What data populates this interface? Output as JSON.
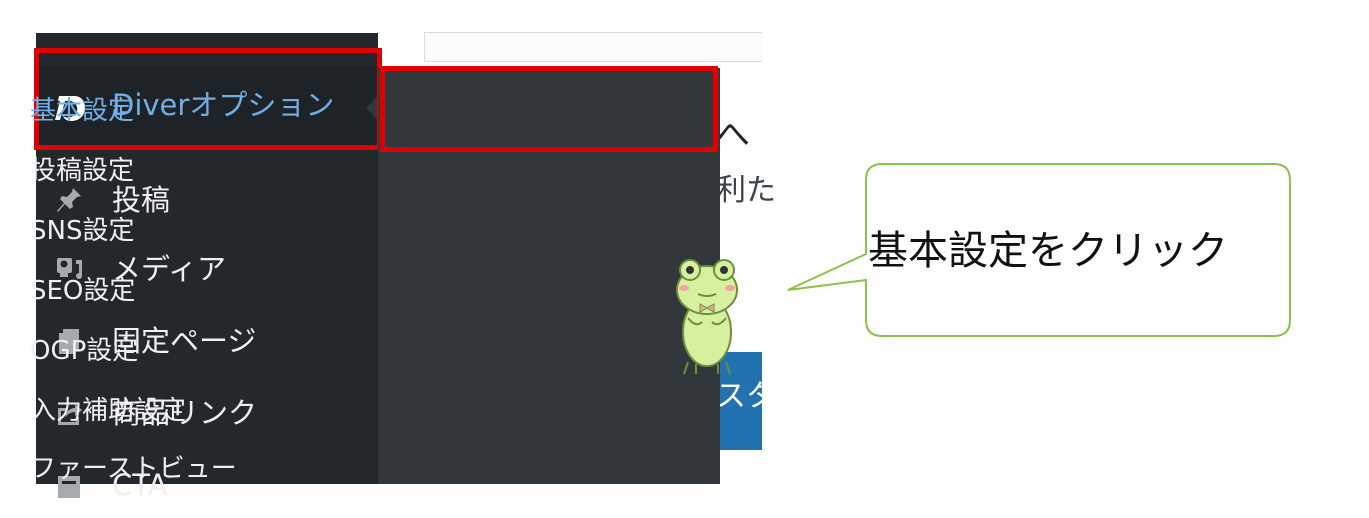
{
  "sidebar": {
    "diver_option_label": "Diverオプション",
    "items": [
      {
        "label": "投稿",
        "icon": "pin-icon"
      },
      {
        "label": "メディア",
        "icon": "media-icon"
      },
      {
        "label": "固定ページ",
        "icon": "page-icon"
      },
      {
        "label": "商品リンク",
        "icon": "external-link-icon"
      },
      {
        "label": "CTA",
        "icon": "cta-icon"
      }
    ]
  },
  "submenu": {
    "items": [
      {
        "label": "基本設定",
        "active": true
      },
      {
        "label": "投稿設定"
      },
      {
        "label": "SNS設定"
      },
      {
        "label": "SEO設定"
      },
      {
        "label": "OGP設定"
      },
      {
        "label": "入力補助設定"
      },
      {
        "label": "ファーストビュー"
      }
    ]
  },
  "background_content": {
    "heading_fragment": "へ",
    "text_fragment": "利た",
    "button_fragment": "スタ"
  },
  "callout": {
    "text": "基本設定をクリック"
  },
  "colors": {
    "sidebar_bg": "#23282d",
    "submenu_bg": "#32373c",
    "highlight_red": "#e00000",
    "link_blue": "#72aee6",
    "bubble_border": "#8bc34a"
  }
}
